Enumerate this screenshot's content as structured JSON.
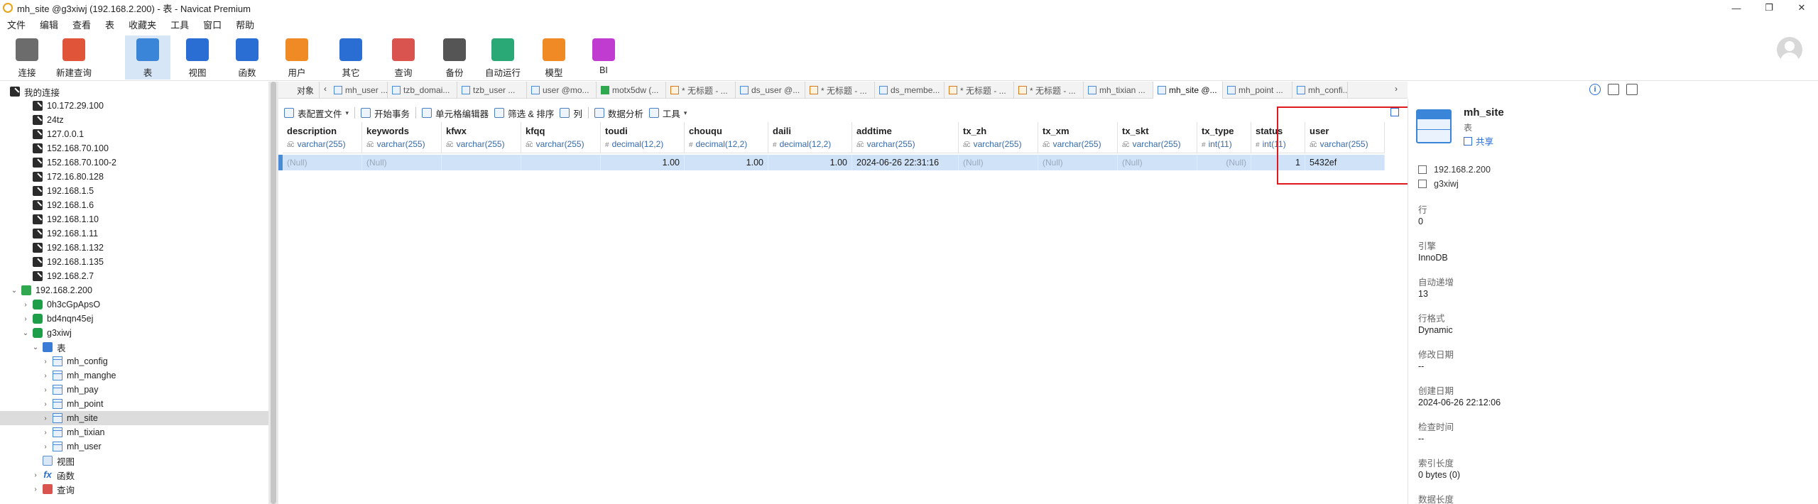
{
  "window": {
    "title": "mh_site @g3xiwj (192.168.2.200) - 表 - Navicat Premium",
    "minimize": "—",
    "restore": "❐",
    "close": "✕"
  },
  "menu": [
    "文件",
    "编辑",
    "查看",
    "表",
    "收藏夹",
    "工具",
    "窗口",
    "帮助"
  ],
  "toolbar": [
    {
      "label": "连接",
      "icon": "connection-icon",
      "color": "#6c6c6c"
    },
    {
      "label": "新建查询",
      "icon": "new-query-icon",
      "color": "#e0553a"
    },
    {
      "label": "表",
      "icon": "table-icon",
      "color": "#3a85d8",
      "active": true
    },
    {
      "label": "视图",
      "icon": "view-icon",
      "color": "#2a6ed4"
    },
    {
      "label": "函数",
      "icon": "function-icon",
      "color": "#2a6ed4"
    },
    {
      "label": "用户",
      "icon": "user-icon",
      "color": "#f08a24"
    },
    {
      "label": "其它",
      "icon": "other-icon",
      "color": "#2a6ed4"
    },
    {
      "label": "查询",
      "icon": "query-icon",
      "color": "#d9534f"
    },
    {
      "label": "备份",
      "icon": "backup-icon",
      "color": "#555555"
    },
    {
      "label": "自动运行",
      "icon": "automation-icon",
      "color": "#2aa876"
    },
    {
      "label": "模型",
      "icon": "model-icon",
      "color": "#f08a24"
    },
    {
      "label": "BI",
      "icon": "bi-icon",
      "color": "#c03bd0"
    }
  ],
  "nav": {
    "root_label": "我的连接",
    "items": [
      {
        "label": "10.172.29.100",
        "type": "conn"
      },
      {
        "label": "24tz",
        "type": "conn"
      },
      {
        "label": "127.0.0.1",
        "type": "conn"
      },
      {
        "label": "152.168.70.100",
        "type": "conn"
      },
      {
        "label": "152.168.70.100-2",
        "type": "conn"
      },
      {
        "label": "172.16.80.128",
        "type": "conn"
      },
      {
        "label": "192.168.1.5",
        "type": "conn"
      },
      {
        "label": "192.168.1.6",
        "type": "conn"
      },
      {
        "label": "192.168.1.10",
        "type": "conn"
      },
      {
        "label": "192.168.1.11",
        "type": "conn"
      },
      {
        "label": "192.168.1.132",
        "type": "conn"
      },
      {
        "label": "192.168.1.135",
        "type": "conn"
      },
      {
        "label": "192.168.2.7",
        "type": "conn"
      },
      {
        "label": "192.168.2.200",
        "type": "conn-active",
        "expanded": true
      },
      {
        "label": "0h3cGpApsO",
        "type": "db"
      },
      {
        "label": "bd4nqn45ej",
        "type": "db"
      },
      {
        "label": "g3xiwj",
        "type": "db",
        "expanded": true
      },
      {
        "label": "表",
        "type": "table-folder",
        "expanded": true
      },
      {
        "label": "mh_config",
        "type": "table"
      },
      {
        "label": "mh_manghe",
        "type": "table"
      },
      {
        "label": "mh_pay",
        "type": "table"
      },
      {
        "label": "mh_point",
        "type": "table"
      },
      {
        "label": "mh_site",
        "type": "table",
        "selected": true
      },
      {
        "label": "mh_tixian",
        "type": "table"
      },
      {
        "label": "mh_user",
        "type": "table"
      },
      {
        "label": "视图",
        "type": "view"
      },
      {
        "label": "函数",
        "type": "func"
      },
      {
        "label": "查询",
        "type": "query"
      }
    ]
  },
  "tabs": [
    {
      "label": "对象",
      "kind": "obj"
    },
    {
      "label": "mh_user ...",
      "kind": "tbl"
    },
    {
      "label": "tzb_domai...",
      "kind": "tbl"
    },
    {
      "label": "tzb_user ...",
      "kind": "tbl"
    },
    {
      "label": "user @mo...",
      "kind": "tbl"
    },
    {
      "label": "motx5dw (...",
      "kind": "mdl"
    },
    {
      "label": "* 无标题 - ...",
      "kind": "qry"
    },
    {
      "label": "ds_user @...",
      "kind": "tbl"
    },
    {
      "label": "* 无标题 - ...",
      "kind": "qry"
    },
    {
      "label": "ds_membe...",
      "kind": "tbl"
    },
    {
      "label": "* 无标题 - ...",
      "kind": "qry"
    },
    {
      "label": "* 无标题 - ...",
      "kind": "qry"
    },
    {
      "label": "mh_tixian ...",
      "kind": "tbl"
    },
    {
      "label": "mh_site @...",
      "kind": "tbl",
      "active": true
    },
    {
      "label": "mh_point ...",
      "kind": "tbl"
    },
    {
      "label": "mh_confi...",
      "kind": "tbl"
    }
  ],
  "object_toolbar": {
    "config_file": "表配置文件",
    "begin_transaction": "开始事务",
    "cell_editor": "单元格编辑器",
    "filter_sort": "筛选 & 排序",
    "columns": "列",
    "data_analysis": "数据分析",
    "tools": "工具"
  },
  "grid": {
    "columns": [
      {
        "name": "description",
        "type": "varchar(255)",
        "mark": "a͡c"
      },
      {
        "name": "keywords",
        "type": "varchar(255)",
        "mark": "a͡c"
      },
      {
        "name": "kfwx",
        "type": "varchar(255)",
        "mark": "a͡c"
      },
      {
        "name": "kfqq",
        "type": "varchar(255)",
        "mark": "a͡c"
      },
      {
        "name": "toudi",
        "type": "decimal(12,2)",
        "mark": "#"
      },
      {
        "name": "chouqu",
        "type": "decimal(12,2)",
        "mark": "#"
      },
      {
        "name": "daili",
        "type": "decimal(12,2)",
        "mark": "#"
      },
      {
        "name": "addtime",
        "type": "varchar(255)",
        "mark": "a͡c"
      },
      {
        "name": "tx_zh",
        "type": "varchar(255)",
        "mark": "a͡c"
      },
      {
        "name": "tx_xm",
        "type": "varchar(255)",
        "mark": "a͡c"
      },
      {
        "name": "tx_skt",
        "type": "varchar(255)",
        "mark": "a͡c"
      },
      {
        "name": "tx_type",
        "type": "int(11)",
        "mark": "#"
      },
      {
        "name": "status",
        "type": "int(11)",
        "mark": "#"
      },
      {
        "name": "user",
        "type": "varchar(255)",
        "mark": "a͡c"
      }
    ],
    "rows": [
      [
        "(Null)",
        "(Null)",
        "",
        "",
        "1.00",
        "1.00",
        "1.00",
        "2024-06-26 22:31:16",
        "(Null)",
        "(Null)",
        "(Null)",
        "(Null)",
        "1",
        "5432ef"
      ]
    ]
  },
  "info": {
    "name": "mh_site",
    "kind": "表",
    "share": "共享",
    "host": "192.168.2.200",
    "database": "g3xiwj",
    "fields": [
      {
        "label": "行",
        "value": "0"
      },
      {
        "label": "引擎",
        "value": "InnoDB"
      },
      {
        "label": "自动递增",
        "value": "13"
      },
      {
        "label": "行格式",
        "value": "Dynamic"
      },
      {
        "label": "修改日期",
        "value": "--"
      },
      {
        "label": "创建日期",
        "value": "2024-06-26 22:12:06"
      },
      {
        "label": "检查时间",
        "value": "--"
      },
      {
        "label": "索引长度",
        "value": "0 bytes (0)"
      },
      {
        "label": "数据长度",
        "value": ""
      }
    ]
  }
}
